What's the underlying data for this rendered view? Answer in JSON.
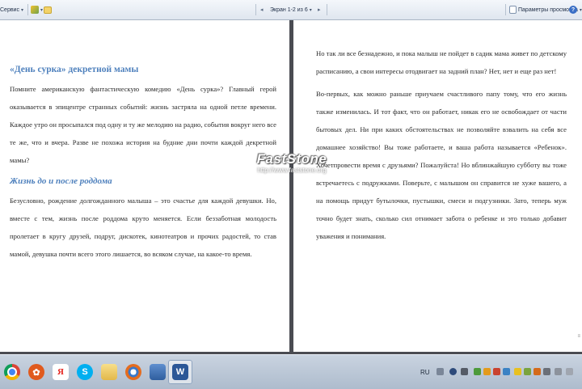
{
  "toolbar": {
    "service_label": "Сервис",
    "page_indicator": "Экран 1-2 из 6",
    "view_options_label": "Параметры просмотра"
  },
  "left_page": {
    "title": "«День сурка» декретной мамы",
    "paragraph1": "Помните американскую фантастическую комедию «День сурка»? Главный герой оказывается в эпицентре странных событий: жизнь застряла на одной петле времени. Каждое утро он просыпался под одну и ту же мелодию на радио, события вокруг него все те же, что и вчера. Разве не похожа история на будние дни почти каждой декретной мамы?",
    "subtitle": "Жизнь до и после роддома",
    "paragraph2": "Безусловно, рождение долгожданного малыша – это счастье для каждой девушки. Но, вместе с тем, жизнь после роддома круто меняется. Если беззаботная молодость пролетает в кругу друзей, подруг, дискотек, кинотеатров и прочих радостей, то став мамой, девушка почти всего этого лишается, во всяком случае, на какое-то время."
  },
  "right_page": {
    "paragraph1": "Но так ли все безнадежно, и пока малыш не пойдет в садик мама живет по детскому расписанию, а свои интересы отодвигает на задний план? Нет, нет и еще раз нет!",
    "paragraph2": "Во-первых, как можно раньше приучаем счастливого папу тому, что его жизнь также изменилась. И тот факт, что он работает, никак его не освобождает от части бытовых дел. Ни при каких обстоятельствах не позволяйте взвалить на себя все домашнее хозяйство! Вы тоже работаете, и ваша работа называется «Ребенок». Хочетпровести время с друзьями? Пожалуйста! Но вблинжайшую субботу вы тоже встречаетесь с подружками. Поверьте, с малышом он справится не хуже вашего, а на помощь придут бутылочки, пустышки, смеси и подгузники. Зато, теперь муж точно будет знать, сколько сил отнимает забота о ребенке и это только добавит уважения и понимания."
  },
  "watermark": {
    "brand": "FastStone",
    "url": "http://www.faststone.org"
  },
  "taskbar": {
    "language": "RU",
    "apps": [
      "chrome-icon",
      "media-player-icon",
      "yandex-browser-icon",
      "skype-icon",
      "file-explorer-icon",
      "browser-icon",
      "image-viewer-icon",
      "word-icon"
    ]
  },
  "colors": {
    "heading": "#4f81bd",
    "taskbar": "#b7c4d4",
    "toolbar": "#e8edf4"
  }
}
